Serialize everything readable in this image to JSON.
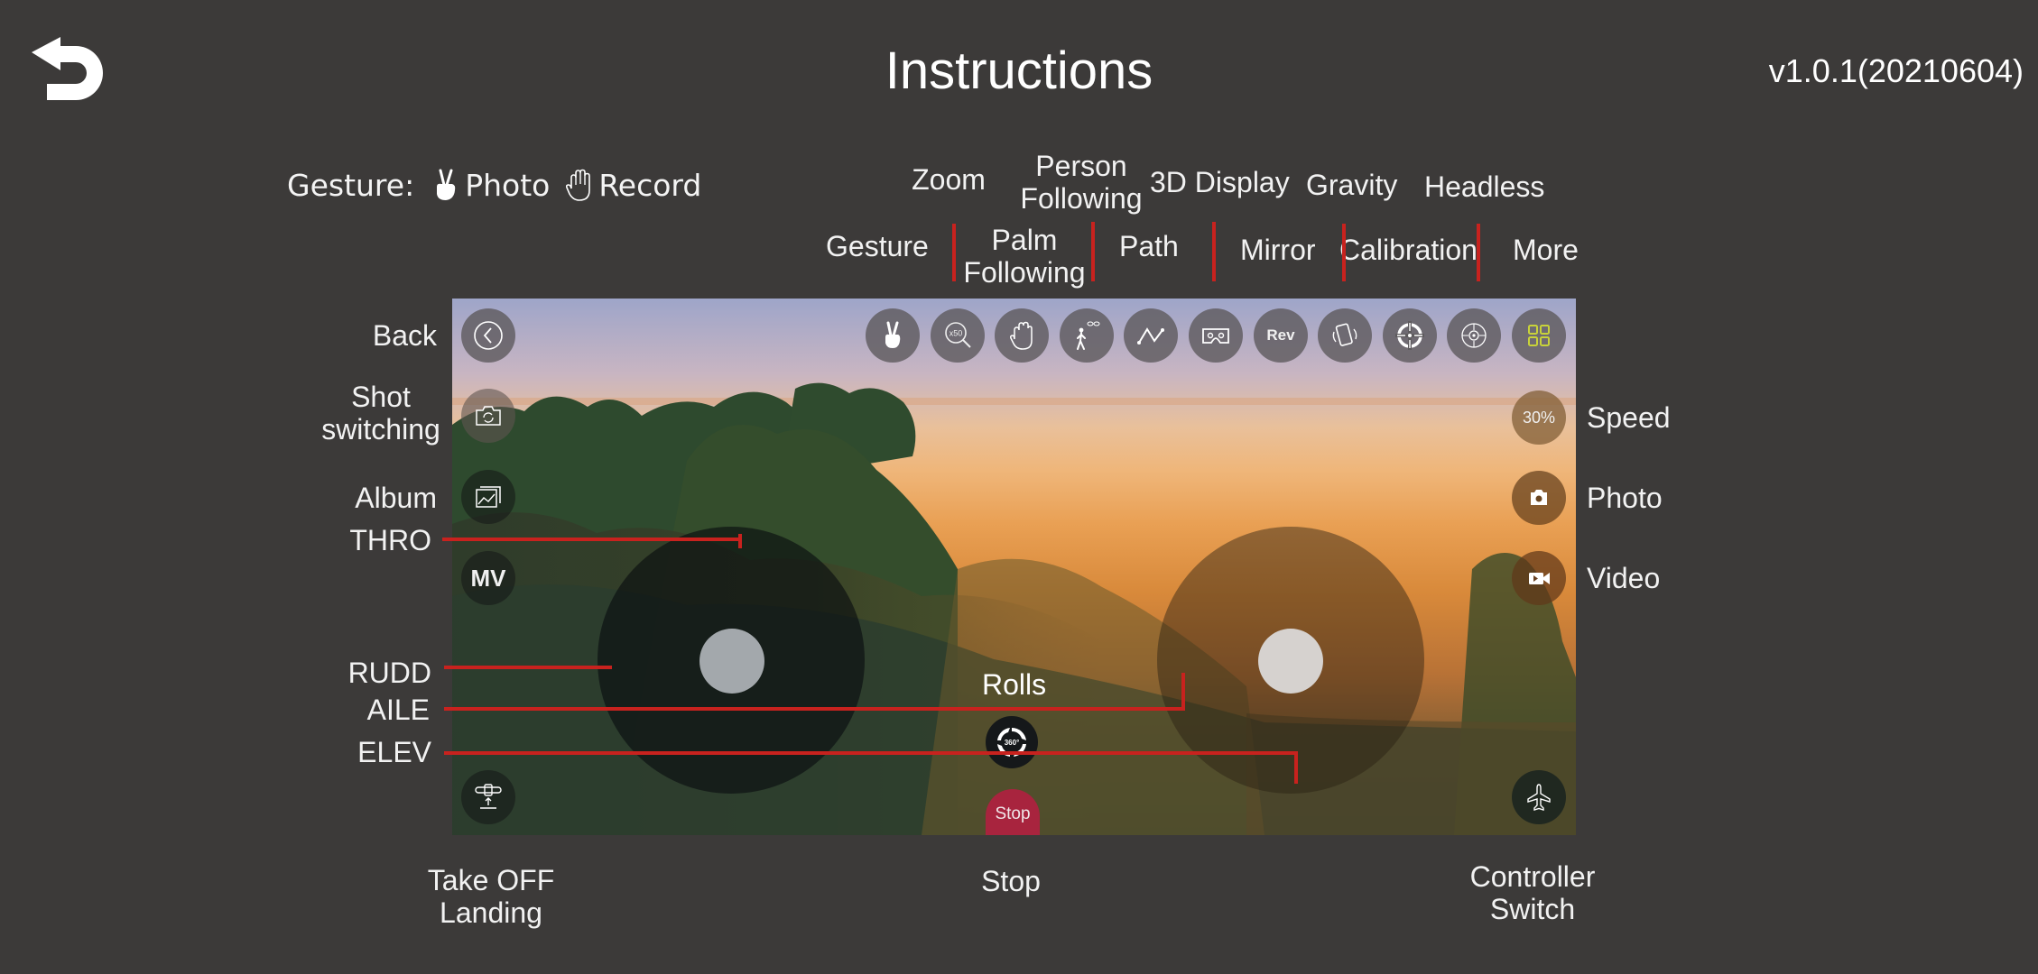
{
  "header": {
    "title": "Instructions",
    "version": "v1.0.1(20210604)",
    "back_icon": "undo-arrow-icon"
  },
  "gesture_legend": {
    "label": "Gesture:",
    "items": [
      {
        "icon": "victory-hand-icon",
        "label": "Photo"
      },
      {
        "icon": "open-palm-icon",
        "label": "Record"
      }
    ]
  },
  "top_labels": {
    "upper_row": [
      {
        "id": "zoom",
        "lines": [
          "Zoom"
        ]
      },
      {
        "id": "person-following",
        "lines": [
          "Person",
          "Following"
        ]
      },
      {
        "id": "3d-display",
        "lines": [
          "3D Display"
        ]
      },
      {
        "id": "gravity",
        "lines": [
          "Gravity"
        ]
      },
      {
        "id": "headless",
        "lines": [
          "Headless"
        ]
      }
    ],
    "lower_row": [
      {
        "id": "gesture",
        "lines": [
          "Gesture"
        ]
      },
      {
        "id": "palm-following",
        "lines": [
          "Palm",
          "Following"
        ]
      },
      {
        "id": "path",
        "lines": [
          "Path"
        ]
      },
      {
        "id": "mirror",
        "lines": [
          "Mirror"
        ]
      },
      {
        "id": "calibration",
        "lines": [
          "Calibration"
        ]
      },
      {
        "id": "more",
        "lines": [
          "More"
        ]
      }
    ]
  },
  "toolbar": [
    {
      "id": "gesture",
      "icon": "victory-hand-icon"
    },
    {
      "id": "zoom",
      "icon": "zoom-x50-icon",
      "text": "x50"
    },
    {
      "id": "palm-following",
      "icon": "open-palm-icon"
    },
    {
      "id": "person-following",
      "icon": "person-walking-drone-icon"
    },
    {
      "id": "path",
      "icon": "path-line-icon"
    },
    {
      "id": "3d-display",
      "icon": "vr-goggles-icon"
    },
    {
      "id": "mirror",
      "icon": "rev-icon",
      "text": "Rev"
    },
    {
      "id": "gravity",
      "icon": "phone-rotate-icon"
    },
    {
      "id": "calibration",
      "icon": "crosshair-calibration-icon"
    },
    {
      "id": "headless",
      "icon": "compass-target-icon"
    },
    {
      "id": "more",
      "icon": "grid-four-icon",
      "accent": "#c8d23a"
    }
  ],
  "left_labels": {
    "back": [
      "Back"
    ],
    "shot_switching": [
      "Shot",
      "switching"
    ],
    "album": [
      "Album"
    ],
    "thro": [
      "THRO"
    ],
    "rudd": [
      "RUDD"
    ],
    "aile": [
      "AILE"
    ],
    "elev": [
      "ELEV"
    ]
  },
  "left_controls": {
    "back": {
      "icon": "chevron-left-circle-icon"
    },
    "shot_switching": {
      "icon": "camera-switch-icon"
    },
    "album": {
      "icon": "album-image-icon"
    },
    "mv": {
      "text": "MV"
    },
    "takeoff": {
      "icon": "takeoff-landing-icon"
    }
  },
  "right_controls": {
    "speed": {
      "text": "30%",
      "label": "Speed"
    },
    "photo": {
      "icon": "camera-icon",
      "label": "Photo"
    },
    "video": {
      "icon": "video-camera-icon",
      "label": "Video"
    },
    "controller": {
      "icon": "airplane-icon"
    }
  },
  "center_controls": {
    "rolls_label": "Rolls",
    "rolls_badge": "360°",
    "stop_button": "Stop"
  },
  "bottom_labels": {
    "takeoff": [
      "Take OFF",
      "Landing"
    ],
    "stop": [
      "Stop"
    ],
    "controller": [
      "Controller",
      "Switch"
    ]
  },
  "colors": {
    "background": "#3c3a39",
    "marker_red": "#c8221e",
    "stop_red": "#a8243e",
    "more_accent": "#c8d23a"
  }
}
